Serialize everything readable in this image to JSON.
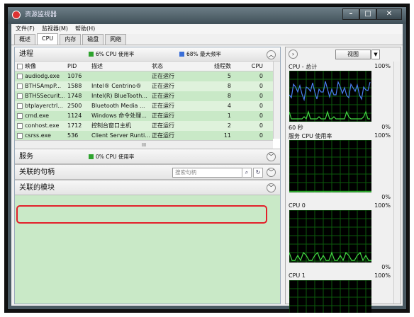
{
  "window": {
    "title": "资源监视器"
  },
  "menu": [
    "文件(F)",
    "监视器(M)",
    "帮助(H)"
  ],
  "tabs": [
    "概述",
    "CPU",
    "内存",
    "磁盘",
    "网络"
  ],
  "process": {
    "title": "进程",
    "cpu_usage": "6% CPU 使用率",
    "max_freq": "68% 最大频率",
    "columns": [
      "映像",
      "PID",
      "描述",
      "状态",
      "线程数",
      "CPU"
    ],
    "rows": [
      [
        "audiodg.exe",
        "1076",
        "",
        "正在运行",
        "5",
        "0"
      ],
      [
        "BTHSAmpP...",
        "1588",
        "Intel® Centrino®",
        "正在运行",
        "8",
        "0"
      ],
      [
        "BTHSSecurit...",
        "1748",
        "Intel(R) BlueTooth...",
        "正在运行",
        "8",
        "0"
      ],
      [
        "btplayerctrl...",
        "2500",
        "Bluetooth Media ...",
        "正在运行",
        "4",
        "0"
      ],
      [
        "cmd.exe",
        "1124",
        "Windows 命令处理...",
        "正在运行",
        "1",
        "0"
      ],
      [
        "conhost.exe",
        "1712",
        "控制台窗口主机",
        "正在运行",
        "2",
        "0"
      ],
      [
        "csrss.exe",
        "536",
        "Client Server Runti...",
        "正在运行",
        "11",
        "0"
      ]
    ],
    "hscroll": "III"
  },
  "services": {
    "title": "服务",
    "cpu_usage": "0% CPU 使用率"
  },
  "handles": {
    "title": "关联的句柄",
    "search_placeholder": "搜索句柄"
  },
  "modules": {
    "title": "关联的模块"
  },
  "right": {
    "view": "视图",
    "cpu_total": "CPU - 总计",
    "pct100": "100%",
    "pct0": "0%",
    "time": "60 秒",
    "service_cpu": "服务 CPU 使用率",
    "cpu0": "CPU 0",
    "cpu1": "CPU 1"
  },
  "colors": {
    "accent": "#2fa32f",
    "line_total": "#4a7ef0",
    "line_green": "#44d944",
    "highlight": "#e2202a"
  }
}
